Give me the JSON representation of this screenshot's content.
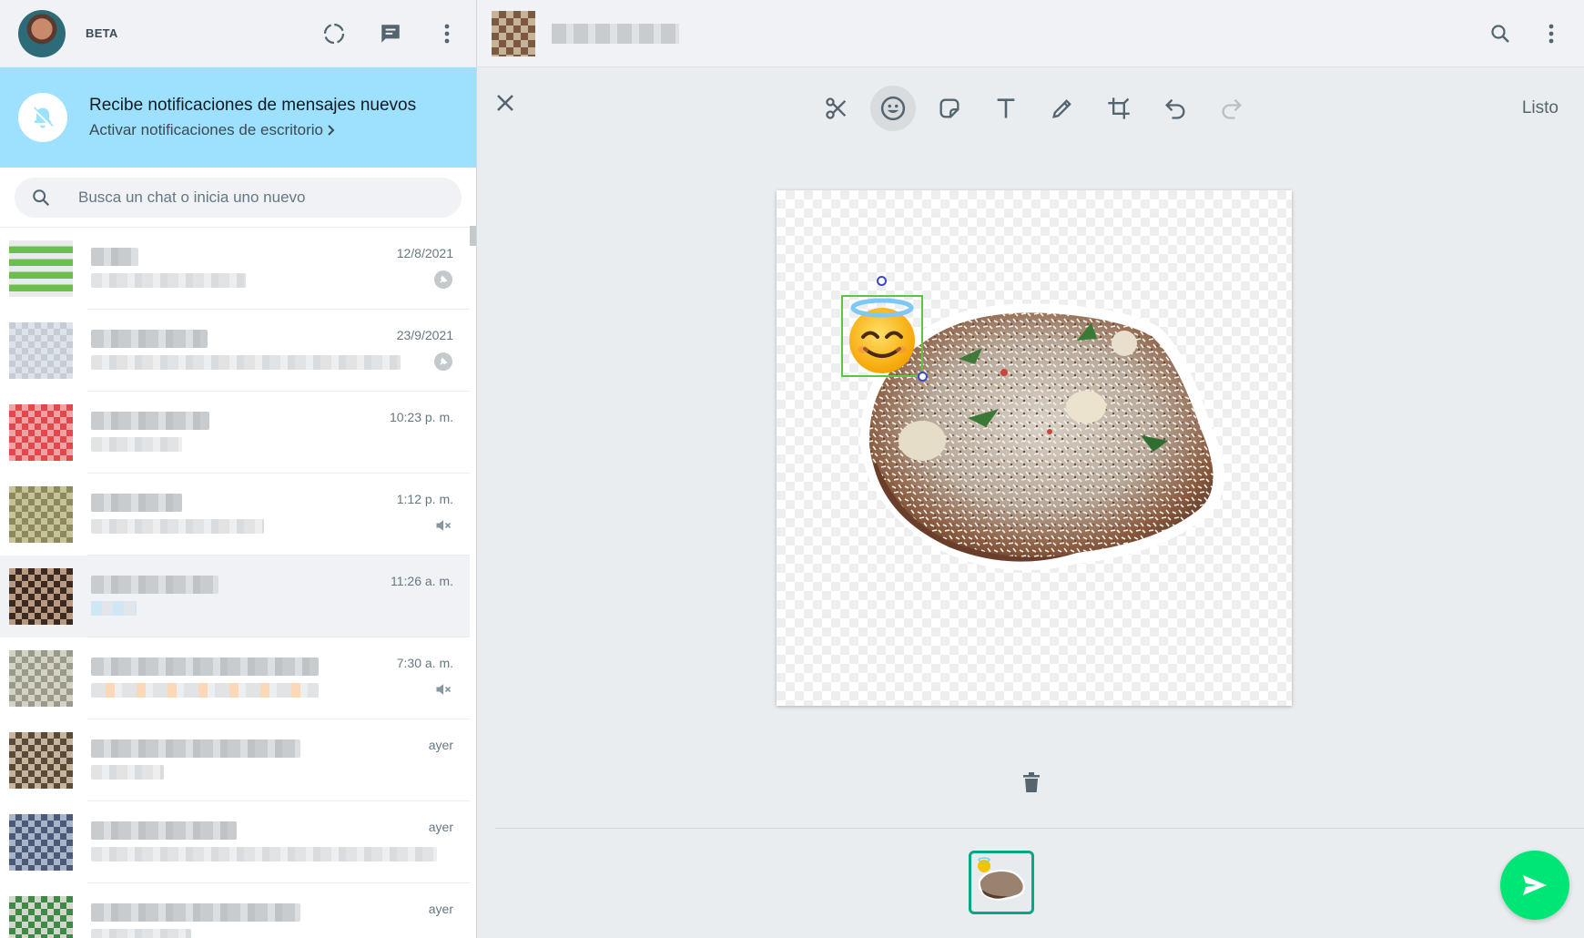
{
  "left": {
    "badge": "BETA",
    "notification": {
      "title": "Recibe notificaciones de mensajes nuevos",
      "action": "Activar notificaciones de escritorio"
    },
    "search": {
      "placeholder": "Busca un chat o inicia uno nuevo"
    },
    "chats": [
      {
        "time": "12/8/2021",
        "status": "pin-icon"
      },
      {
        "time": "23/9/2021",
        "status": "pin-icon"
      },
      {
        "time": "10:23 p. m.",
        "status": ""
      },
      {
        "time": "1:12 p. m.",
        "status": "muted-icon"
      },
      {
        "time": "11:26 a. m.",
        "status": ""
      },
      {
        "time": "7:30 a. m.",
        "status": "muted-icon"
      },
      {
        "time": "ayer",
        "status": ""
      },
      {
        "time": "ayer",
        "status": ""
      },
      {
        "time": "ayer",
        "status": ""
      }
    ]
  },
  "editor": {
    "done_label": "Listo",
    "tools": [
      "scissors-icon",
      "emoji-icon",
      "sticker-icon",
      "text-icon",
      "pencil-icon",
      "crop-icon",
      "undo-icon",
      "redo-icon"
    ],
    "selected_tool": "emoji-icon"
  },
  "colors": {
    "accent": "#00a884",
    "send": "#00e676",
    "banner": "#9de1fe",
    "selection": "#5ac83a"
  }
}
